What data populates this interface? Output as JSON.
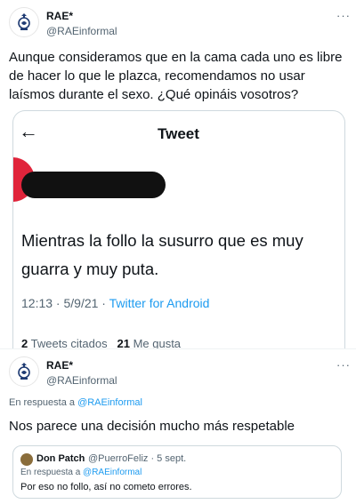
{
  "tweet1": {
    "author_name": "RAE*",
    "author_handle": "@RAEinformal",
    "more": "···",
    "text": "Aunque consideramos que en la cama cada uno es libre de hacer lo que le plazca, recomendamos no usar laísmos durante el sexo. ¿Qué opináis vosotros?",
    "embedded": {
      "back_icon": "arrow-left-icon",
      "header_title": "Tweet",
      "text": "Mientras la follo la susurro que es muy guarra y muy puta.",
      "time": "12:13 · 5/9/21 ·",
      "app": "Twitter for Android",
      "counts_quotes": "2",
      "counts_quotes_label": "Tweets citados",
      "counts_likes": "21",
      "counts_likes_label": "Me gusta"
    }
  },
  "tweet2": {
    "author_name": "RAE*",
    "author_handle": "@RAEinformal",
    "more": "···",
    "reply_prefix": "En respuesta a",
    "reply_handle": "@RAEinformal",
    "text": "Nos parece una decisión mucho más respetable",
    "quote": {
      "name": "Don Patch",
      "meta": "@PuerroFeliz · 5 sept.",
      "reply_prefix": "En respuesta a",
      "reply_handle": "@RAEinformal",
      "text": "Por eso no follo, así no cometo errores."
    }
  },
  "colors": {
    "link": "#1d9bf0",
    "muted": "#536471",
    "redaction": "#111111",
    "red_avatar": "#e0243b"
  }
}
